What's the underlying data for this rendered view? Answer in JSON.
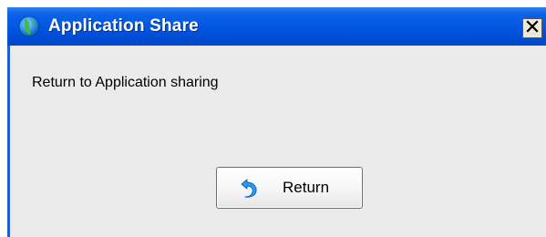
{
  "window": {
    "title": "Application Share",
    "title_icon": "globe-icon",
    "close_icon": "close-icon"
  },
  "dialog": {
    "message": "Return to Application sharing",
    "return_button": {
      "label": "Return",
      "icon": "return-arrow-icon"
    }
  },
  "colors": {
    "titlebar": "#0053df",
    "client_background": "#ebebeb",
    "title_text": "#ffffff"
  }
}
